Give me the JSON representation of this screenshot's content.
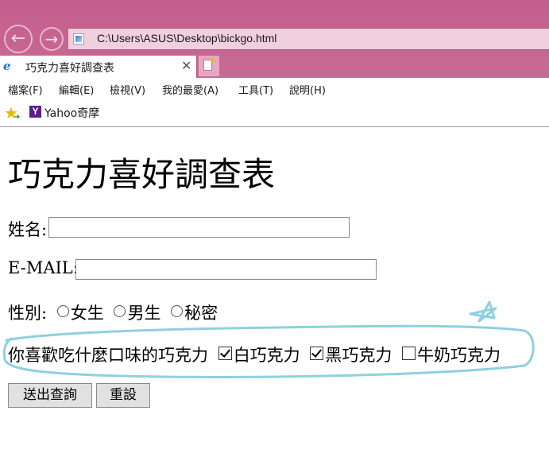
{
  "browser": {
    "address": "C:\\Users\\ASUS\\Desktop\\bickgo.html",
    "tab_title": "巧克力喜好調查表",
    "tab_close": "✕",
    "menu": [
      "檔案(F)",
      "編輯(E)",
      "檢視(V)",
      "我的最愛(A)",
      "工具(T)",
      "說明(H)"
    ],
    "favorites": {
      "yahoo_logo": "Y",
      "yahoo_label": "Yahoo奇摩"
    }
  },
  "page": {
    "title": "巧克力喜好調查表",
    "name_label": "姓名:",
    "name_value": "",
    "email_label": "E-MAIL:",
    "email_value": "",
    "gender_label": "性別:",
    "gender_options": [
      "女生",
      "男生",
      "秘密"
    ],
    "flavor_question": "你喜歡吃什麼口味的巧克力",
    "flavors": [
      {
        "label": "白巧克力",
        "checked": true
      },
      {
        "label": "黑巧克力",
        "checked": true
      },
      {
        "label": "牛奶巧克力",
        "checked": false
      }
    ],
    "submit_label": "送出查詢",
    "reset_label": "重設"
  },
  "colors": {
    "chrome_pink": "#c45e8e",
    "address_bg": "#f0cfdf",
    "annotation_stroke": "#8fd0e0"
  },
  "icons": {
    "back": "back-arrow-icon",
    "forward": "forward-arrow-icon",
    "favorites": "star-add-icon",
    "tab": "ie-icon"
  }
}
